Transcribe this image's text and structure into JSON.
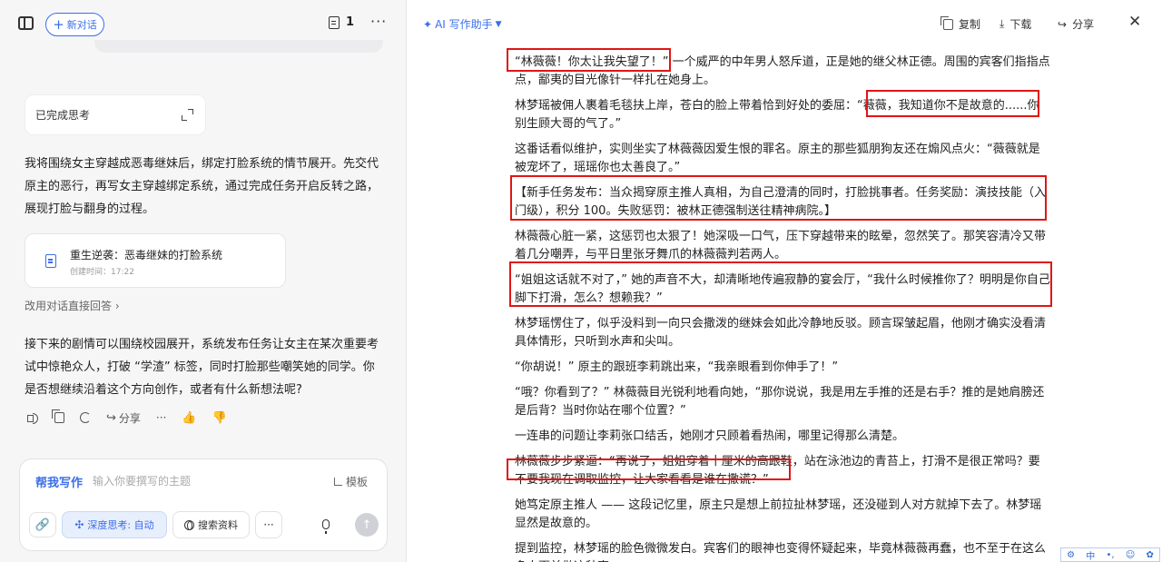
{
  "left": {
    "new_chat": "新对话",
    "doc_count": "1",
    "thinking_done": "已完成思考",
    "message1": "我将围绕女主穿越成恶毒继妹后，绑定打脸系统的情节展开。先交代原主的恶行，再写女主穿越绑定系统，通过完成任务开启反转之路，展现打脸与翻身的过程。",
    "doc_card": {
      "title": "重生逆袭：恶毒继妹的打脸系统",
      "time": "创建时间：17:22"
    },
    "switch_link": "改用对话直接回答",
    "message2": "接下来的剧情可以围绕校园展开，系统发布任务让女主在某次重要考试中惊艳众人，打破 “学渣” 标签，同时打脸那些嘲笑她的同学。你是否想继续沿着这个方向创作，或者有什么新想法呢?",
    "actions": {
      "share": "分享"
    },
    "input": {
      "help_write": "帮我写作",
      "placeholder": "输入你要撰写的主题",
      "template": "模板",
      "deep_think": "深度思考: 自动",
      "search": "搜索资料"
    }
  },
  "right": {
    "ai_assistant": "AI 写作助手",
    "copy": "复制",
    "download": "下载",
    "share": "分享",
    "paragraphs": [
      "“林薇薇！你太让我失望了！” 一个威严的中年男人怒斥道，正是她的继父林正德。周围的宾客们指指点点，鄙夷的目光像针一样扎在她身上。",
      "林梦瑶被佣人裹着毛毯扶上岸，苍白的脸上带着恰到好处的委屈：“薇薇，我知道你不是故意的......你别生顾大哥的气了。”",
      "这番话看似维护，实则坐实了林薇薇因爱生恨的罪名。原主的那些狐朋狗友还在煽风点火：“薇薇就是被宠坏了，瑶瑶你也太善良了。”",
      "【新手任务发布：当众揭穿原主推人真相，为自己澄清的同时，打脸挑事者。任务奖励：演技技能（入门级），积分 100。失败惩罚：被林正德强制送往精神病院。】",
      "林薇薇心脏一紧，这惩罚也太狠了！她深吸一口气，压下穿越带来的眩晕，忽然笑了。那笑容清冷又带着几分嘲弄，与平日里张牙舞爪的林薇薇判若两人。",
      "“姐姐这话就不对了，” 她的声音不大，却清晰地传遍寂静的宴会厅，“我什么时候推你了？明明是你自己脚下打滑，怎么？想赖我？”",
      "林梦瑶愣住了，似乎没料到一向只会撒泼的继妹会如此冷静地反驳。顾言琛皱起眉，他刚才确实没看清具体情形，只听到水声和尖叫。",
      "“你胡说！” 原主的跟班李莉跳出来，“我亲眼看到你伸手了！”",
      "“哦？你看到了？” 林薇薇目光锐利地看向她，“那你说说，我是用左手推的还是右手？推的是她肩膀还是后背？当时你站在哪个位置？”",
      "一连串的问题让李莉张口结舌，她刚才只顾着看热闹，哪里记得那么清楚。",
      "林薇薇步步紧逼：“再说了，姐姐穿着十厘米的高跟鞋，站在泳池边的青苔上，打滑不是很正常吗？要不要我现在调取监控，让大家看看是谁在撒谎？”",
      "她笃定原主推人 —— 这段记忆里，原主只是想上前拉扯林梦瑶，还没碰到人对方就掉下去了。林梦瑶显然是故意的。",
      "提到监控，林梦瑶的脸色微微发白。宾客们的眼神也变得怀疑起来，毕竟林薇薇再蠢，也不至于在这么多人面前做这种事。"
    ]
  },
  "ime": {
    "lang": "中"
  }
}
